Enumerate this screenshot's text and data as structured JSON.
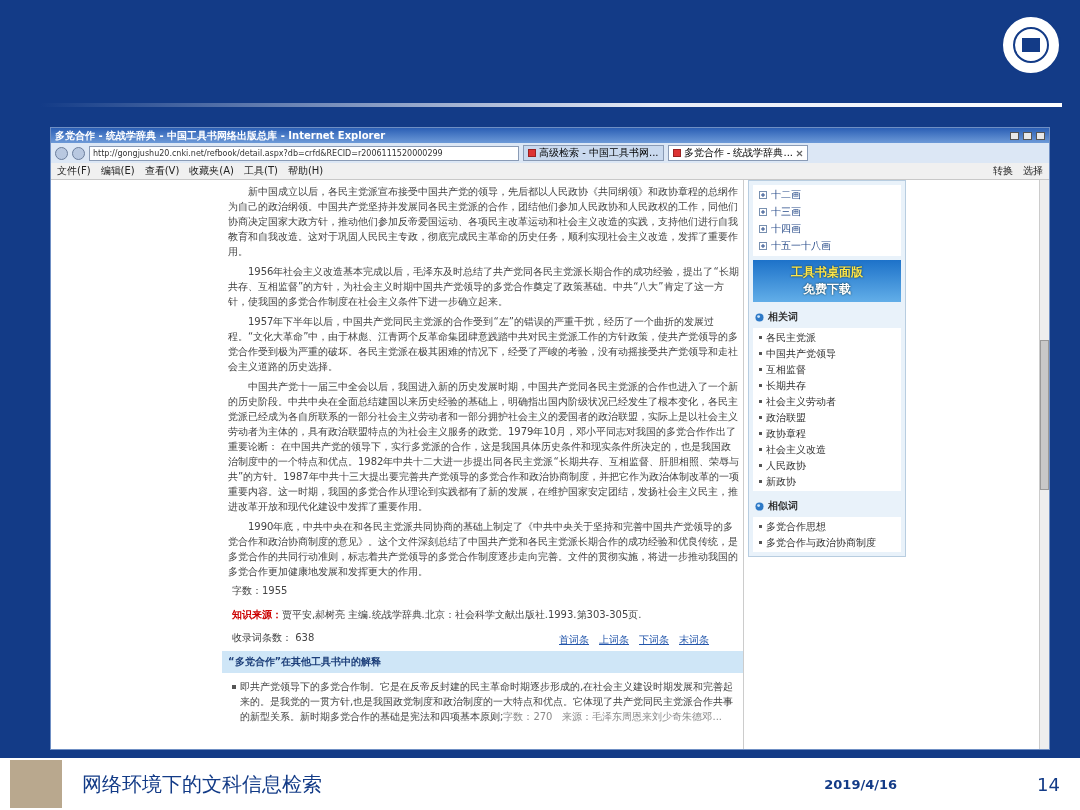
{
  "browser": {
    "title": "多党合作 - 统战学辞典 - 中国工具书网络出版总库 - Internet Explorer",
    "address": "http://gongjushu20.cnki.net/refbook/detail.aspx?db=crfd&RECID=r2006111520000299",
    "tabs": [
      {
        "label": "高级检索 - 中国工具书网...",
        "selected": false
      },
      {
        "label": "多党合作 - 统战学辞典...",
        "selected": true
      }
    ],
    "menu": [
      "文件(F)",
      "编辑(E)",
      "查看(V)",
      "收藏夹(A)",
      "工具(T)",
      "帮助(H)"
    ],
    "tools": [
      "转换",
      "选择"
    ]
  },
  "article": {
    "paragraphs": [
      "新中国成立以后，各民主党派宣布接受中国共产党的领导，先后都以人民政协《共同纲领》和政协章程的总纲作为自己的政治纲领。中国共产党坚持并发展同各民主党派的合作，团结他们参加人民政协和人民政权的工作，同他们协商决定国家大政方针，推动他们参加反帝爱国运动、各项民主改革运动和社会主义改造的实践，支持他们进行自我教育和自我改造。这对于巩固人民民主专政，彻底完成民主革命的历史任务，顺利实现社会主义改造，发挥了重要作用。",
      "1956年社会主义改造基本完成以后，毛泽东及时总结了共产党同各民主党派长期合作的成功经验，提出了“长期共存、互相监督”的方针，为社会主义时期中国共产党领导的多党合作奠定了政策基础。中共“八大”肯定了这一方针，使我国的多党合作制度在社会主义条件下进一步确立起来。",
      "1957年下半年以后，中国共产党同民主党派的合作受到“左”的错误的严重干扰，经历了一个曲折的发展过程。“文化大革命”中，由于林彪、江青两个反革命集团肆意践踏中共对民主党派工作的方针政策，使共产党领导的多党合作受到极为严重的破坏。各民主党派在极其困难的情况下，经受了严峻的考验，没有动摇接受共产党领导和走社会主义道路的历史选择。",
      "中国共产党十一届三中全会以后，我国进入新的历史发展时期，中国共产党同各民主党派的合作也进入了一个新的历史阶段。中共中央在全面总结建国以来历史经验的基础上，明确指出国内阶级状况已经发生了根本变化，各民主党派已经成为各自所联系的一部分社会主义劳动者和一部分拥护社会主义的爱国者的政治联盟，实际上是以社会主义劳动者为主体的，具有政治联盟特点的为社会主义服务的政党。1979年10月，邓小平同志对我国的多党合作作出了重要论断： 在中国共产党的领导下，实行多党派的合作，这是我国具体历史条件和现实条件所决定的，也是我国政治制度中的一个特点和优点。1982年中共十二大进一步提出同各民主党派“长期共存、互相监督、肝胆相照、荣辱与共”的方针。1987年中共十三大提出要完善共产党领导的多党合作和政治协商制度，并把它作为政治体制改革的一项重要内容。这一时期，我国的多党合作从理论到实践都有了新的发展，在维护国家安定团结，发扬社会主义民主，推进改革开放和现代化建设中发挥了重要作用。",
      "1990年底，中共中央在和各民主党派共同协商的基础上制定了《中共中央关于坚持和完善中国共产党领导的多党合作和政治协商制度的意见》。这个文件深刻总结了中国共产党和各民主党派长期合作的成功经验和优良传统，是多党合作的共同行动准则，标志着共产党领导的多党合作制度逐步走向完善。文件的贯彻实施，将进一步推动我国的多党合作更加健康地发展和发挥更大的作用。"
    ],
    "word_count": "字数：1955",
    "source_label": "知识来源：",
    "source_text": "贾平安,郝树亮 主编.统战学辞典.北京：社会科学文献出版社.1993.第303-305页.",
    "entry_count": "收录词条数： 638",
    "nav_links": [
      "首词条",
      "上词条",
      "下词条",
      "末词条"
    ],
    "other_header": "“多党合作”在其他工具书中的解释",
    "other_items": [
      {
        "text": "即共产党领导下的多党合作制。它是在反帝反封建的民主革命时期逐步形成的,在社会主义建设时期发展和完善起来的。是我党的一贯方针,也是我国政党制度和政治制度的一大特点和优点。它体现了共产党同民主党派合作共事的新型关系。新时期多党合作的基础是宪法和四项基本原则;",
        "meta": "字数：270　来源：毛泽东周恩来刘少奇朱德邓..."
      }
    ]
  },
  "sidebar": {
    "strokes": [
      {
        "label": "十二画",
        "expanded": false
      },
      {
        "label": "十三画",
        "expanded": false
      },
      {
        "label": "十四画",
        "expanded": false
      },
      {
        "label": "十五一十八画",
        "expanded": false
      }
    ],
    "banner": [
      "工具书桌面版",
      "免费下载"
    ],
    "groups": [
      {
        "title": "相关词",
        "items": [
          "各民主党派",
          "中国共产党领导",
          "互相监督",
          "长期共存",
          "社会主义劳动者",
          "政治联盟",
          "政协章程",
          "社会主义改造",
          "人民政协",
          "新政协"
        ]
      },
      {
        "title": "相似词",
        "items": [
          "多党合作思想",
          "多党合作与政治协商制度"
        ]
      }
    ]
  },
  "footer": {
    "title": "网络环境下的文科信息检索",
    "date": "2019/4/16",
    "page": "14"
  }
}
